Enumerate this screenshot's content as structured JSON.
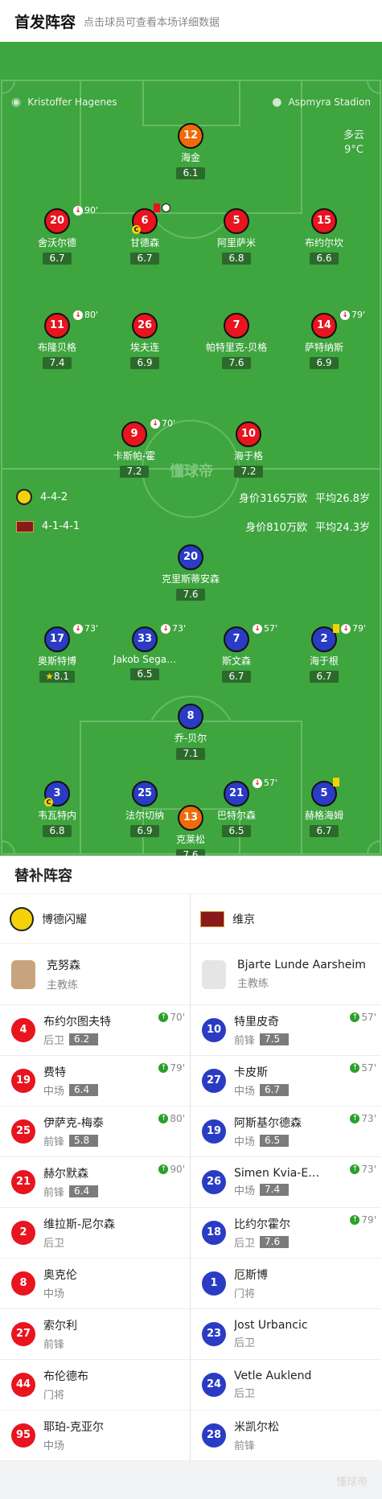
{
  "header": {
    "title": "首发阵容",
    "subtitle": "点击球员可查看本场详细数据"
  },
  "info": {
    "referee": "Kristoffer Hagenes",
    "stadium": "Aspmyra Stadion",
    "weather": "多云",
    "temp": "9°C"
  },
  "watermark": "懂球帝",
  "home_formation": {
    "shape": "4-4-2",
    "value": "身价3165万欧",
    "age": "平均26.8岁"
  },
  "away_formation": {
    "shape": "4-1-4-1",
    "value": "身价810万欧",
    "age": "平均24.3岁"
  },
  "home_lineup": [
    {
      "num": "12",
      "name": "海金",
      "rating": "6.1",
      "event": ""
    },
    {
      "num": "20",
      "name": "舍沃尔德",
      "rating": "6.7",
      "event": "90'"
    },
    {
      "num": "6",
      "name": "甘德森",
      "rating": "6.7",
      "event": ""
    },
    {
      "num": "5",
      "name": "阿里萨米",
      "rating": "6.8",
      "event": ""
    },
    {
      "num": "15",
      "name": "布约尔坎",
      "rating": "6.6",
      "event": ""
    },
    {
      "num": "11",
      "name": "布隆贝格",
      "rating": "7.4",
      "event": "80'"
    },
    {
      "num": "26",
      "name": "埃夫连",
      "rating": "6.9",
      "event": ""
    },
    {
      "num": "7",
      "name": "帕特里克-贝格",
      "rating": "7.6",
      "event": ""
    },
    {
      "num": "14",
      "name": "萨特纳斯",
      "rating": "6.9",
      "event": "79'"
    },
    {
      "num": "9",
      "name": "卡斯帕-霍",
      "rating": "7.2",
      "event": "70'"
    },
    {
      "num": "10",
      "name": "海于格",
      "rating": "7.2",
      "event": ""
    }
  ],
  "away_lineup": [
    {
      "num": "20",
      "name": "克里斯蒂安森",
      "rating": "7.6",
      "event": ""
    },
    {
      "num": "17",
      "name": "奥斯特博",
      "rating": "8.1",
      "event": "73'"
    },
    {
      "num": "33",
      "name": "Jakob Sega…",
      "rating": "6.5",
      "event": "73'"
    },
    {
      "num": "7",
      "name": "斯文森",
      "rating": "6.7",
      "event": "57'"
    },
    {
      "num": "2",
      "name": "海于根",
      "rating": "6.7",
      "event": "79'"
    },
    {
      "num": "8",
      "name": "乔-贝尔",
      "rating": "7.1",
      "event": ""
    },
    {
      "num": "3",
      "name": "韦瓦特内",
      "rating": "6.8",
      "event": ""
    },
    {
      "num": "25",
      "name": "法尔切纳",
      "rating": "6.9",
      "event": ""
    },
    {
      "num": "21",
      "name": "巴特尔森",
      "rating": "6.5",
      "event": "57'"
    },
    {
      "num": "5",
      "name": "赫格海姆",
      "rating": "6.7",
      "event": ""
    },
    {
      "num": "13",
      "name": "克莱松",
      "rating": "7.6",
      "event": ""
    }
  ],
  "subs_title": "替补阵容",
  "home_team": {
    "name": "博德闪耀",
    "coach": "克努森",
    "coach_role": "主教练"
  },
  "away_team": {
    "name": "维京",
    "coach": "Bjarte Lunde Aarsheim",
    "coach_role": "主教练"
  },
  "home_subs": [
    {
      "num": "4",
      "name": "布约尔图夫特",
      "pos": "后卫",
      "rating": "6.2",
      "time": "70'"
    },
    {
      "num": "19",
      "name": "费特",
      "pos": "中场",
      "rating": "6.4",
      "time": "79'"
    },
    {
      "num": "25",
      "name": "伊萨克-梅泰",
      "pos": "前锋",
      "rating": "5.8",
      "time": "80'"
    },
    {
      "num": "21",
      "name": "赫尔默森",
      "pos": "前锋",
      "rating": "6.4",
      "time": "90'"
    },
    {
      "num": "2",
      "name": "维拉斯-尼尔森",
      "pos": "后卫",
      "rating": "",
      "time": ""
    },
    {
      "num": "8",
      "name": "奥克伦",
      "pos": "中场",
      "rating": "",
      "time": ""
    },
    {
      "num": "27",
      "name": "索尔利",
      "pos": "前锋",
      "rating": "",
      "time": ""
    },
    {
      "num": "44",
      "name": "布伦德布",
      "pos": "门将",
      "rating": "",
      "time": ""
    },
    {
      "num": "95",
      "name": "耶珀-克亚尔",
      "pos": "中场",
      "rating": "",
      "time": ""
    }
  ],
  "away_subs": [
    {
      "num": "10",
      "name": "特里皮奇",
      "pos": "前锋",
      "rating": "7.5",
      "time": "57'"
    },
    {
      "num": "27",
      "name": "卡皮斯",
      "pos": "中场",
      "rating": "6.7",
      "time": "57'"
    },
    {
      "num": "19",
      "name": "阿斯基尔德森",
      "pos": "中场",
      "rating": "6.5",
      "time": "73'"
    },
    {
      "num": "26",
      "name": "Simen Kvia-E…",
      "pos": "中场",
      "rating": "7.4",
      "time": "73'"
    },
    {
      "num": "18",
      "name": "比约尔霍尔",
      "pos": "后卫",
      "rating": "7.6",
      "time": "79'"
    },
    {
      "num": "1",
      "name": "厄斯博",
      "pos": "门将",
      "rating": "",
      "time": ""
    },
    {
      "num": "23",
      "name": "Jost Urbancic",
      "pos": "后卫",
      "rating": "",
      "time": ""
    },
    {
      "num": "24",
      "name": "Vetle Auklend",
      "pos": "后卫",
      "rating": "",
      "time": ""
    },
    {
      "num": "28",
      "name": "米凯尔松",
      "pos": "前锋",
      "rating": "",
      "time": ""
    }
  ],
  "colors": {
    "home": "#e8141e",
    "away": "#2a3cc4",
    "keeper": "#f06a0a",
    "pitch": "#3fa53f"
  }
}
